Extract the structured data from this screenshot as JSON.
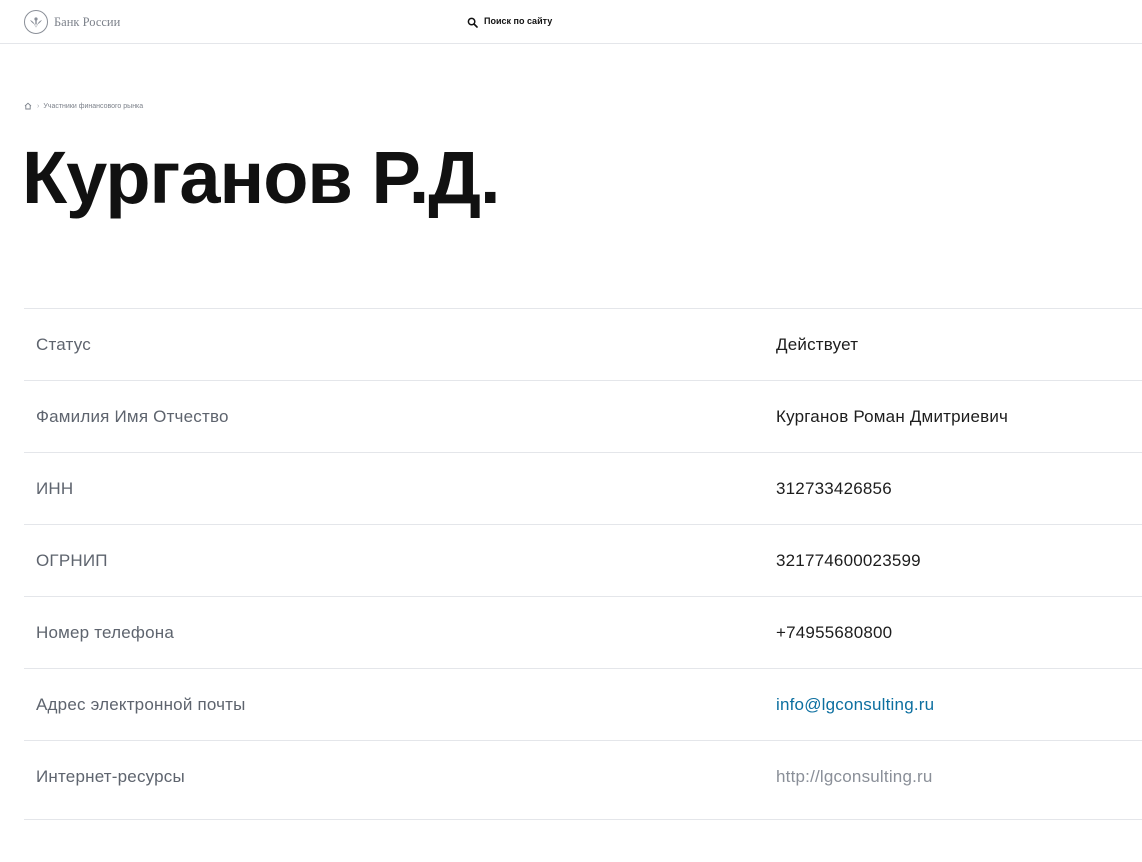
{
  "header": {
    "logo_text": "Банк России",
    "search_label": "Поиск по сайту"
  },
  "breadcrumb": {
    "separator": "›",
    "items": [
      {
        "label": "Участники финансового рынка"
      }
    ]
  },
  "page": {
    "title": "Курганов Р.Д."
  },
  "details": {
    "rows": [
      {
        "label": "Статус",
        "value": "Действует"
      },
      {
        "label": "Фамилия Имя Отчество",
        "value": "Курганов Роман Дмитриевич"
      },
      {
        "label": "ИНН",
        "value": "312733426856"
      },
      {
        "label": "ОГРНИП",
        "value": "321774600023599"
      },
      {
        "label": "Номер телефона",
        "value": "+74955680800"
      },
      {
        "label": "Адрес электронной почты",
        "value": "info@lgconsulting.ru"
      },
      {
        "label": "Интернет-ресурсы",
        "value": "http://lgconsulting.ru"
      }
    ]
  },
  "colors": {
    "link_email": "#0c6fa0",
    "link_web": "#8a8f98",
    "label_text": "#5e646e",
    "divider": "#e4e6ea"
  },
  "icons": {
    "logo": "bank-of-russia-emblem-icon",
    "search": "search-icon",
    "home": "home-icon"
  }
}
